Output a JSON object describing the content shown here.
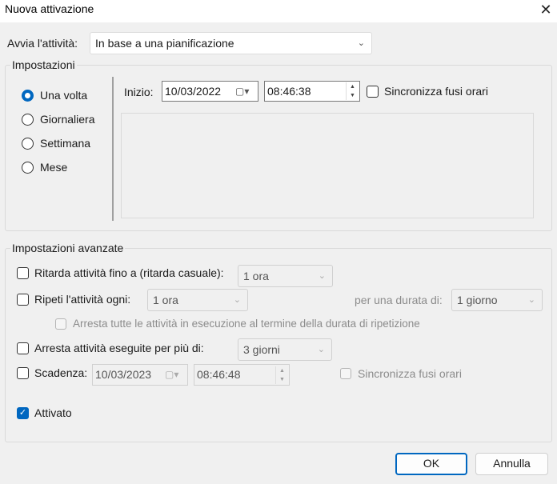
{
  "window": {
    "title": "Nuova attivazione"
  },
  "start_task": {
    "label": "Avvia l'attività:",
    "value": "In base a una pianificazione"
  },
  "settings": {
    "legend": "Impostazioni",
    "options": [
      "Una volta",
      "Giornaliera",
      "Settimana",
      "Mese"
    ],
    "selected": "Una volta",
    "start_label": "Inizio:",
    "start_date": "10/03/2022",
    "start_time": "08:46:38",
    "sync_label": "Sincronizza fusi orari"
  },
  "advanced": {
    "legend": "Impostazioni avanzate",
    "delay": {
      "label": "Ritarda attività fino a (ritarda casuale):",
      "value": "1 ora"
    },
    "repeat": {
      "label": "Ripeti l'attività ogni:",
      "value": "1 ora",
      "duration_label": "per una durata di:",
      "duration_value": "1 giorno"
    },
    "stop_all_label": "Arresta tutte le attività in esecuzione al termine della durata di ripetizione",
    "stop_longer": {
      "label": "Arresta attività eseguite per più di:",
      "value": "3 giorni"
    },
    "expire": {
      "label": "Scadenza:",
      "date": "10/03/2023",
      "time": "08:46:48",
      "sync_label": "Sincronizza fusi orari"
    },
    "enabled": {
      "label": "Attivato",
      "checked": true
    }
  },
  "buttons": {
    "ok": "OK",
    "cancel": "Annulla"
  },
  "colors": {
    "accent": "#0067c0",
    "background": "#f0f0f0"
  }
}
